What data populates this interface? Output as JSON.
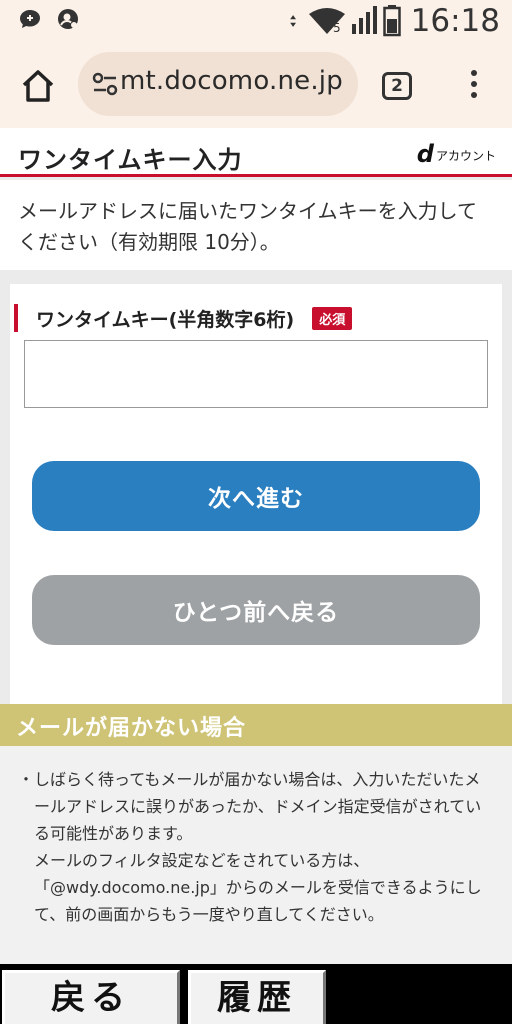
{
  "status_bar": {
    "time": "16:18",
    "network_badge": "5",
    "icons": [
      "chat-icon",
      "account-notification-icon",
      "data-transfer-icon",
      "wifi-icon",
      "signal-icon",
      "battery-icon"
    ]
  },
  "browser": {
    "url": "mt.docomo.ne.jp",
    "tab_count": "2",
    "icons": [
      "home-icon",
      "site-settings-icon",
      "more-vert-icon"
    ]
  },
  "page": {
    "title": "ワンタイムキー入力",
    "logo_mark": "d",
    "logo_text": "アカウント",
    "intro": "メールアドレスに届いたワンタイムキーを入力してください（有効期限 10分）。",
    "form": {
      "label": "ワンタイムキー(半角数字6桁)",
      "required_badge": "必須",
      "input_value": "",
      "next_button": "次へ進む",
      "back_button": "ひとつ前へ戻る"
    },
    "notice": {
      "title": "メールが届かない場合",
      "bullet": "・",
      "line1": "しばらく待ってもメールが届かない場合は、入力いただいたメールアドレスに誤りがあったか、ドメイン指定受信がされている可能性があります。",
      "line2": "メールのフィルタ設定などをされている方は、「@wdy.docomo.ne.jp」からのメールを受信できるようにして、前の画面からもう一度やり直してください。"
    }
  },
  "bottom_nav": {
    "back": "戻る",
    "history": "履歴"
  },
  "colors": {
    "accent_red": "#c8102e",
    "primary_blue": "#2a7fc1",
    "secondary_gray": "#9ea2a4",
    "notice_olive": "#cfc476"
  }
}
